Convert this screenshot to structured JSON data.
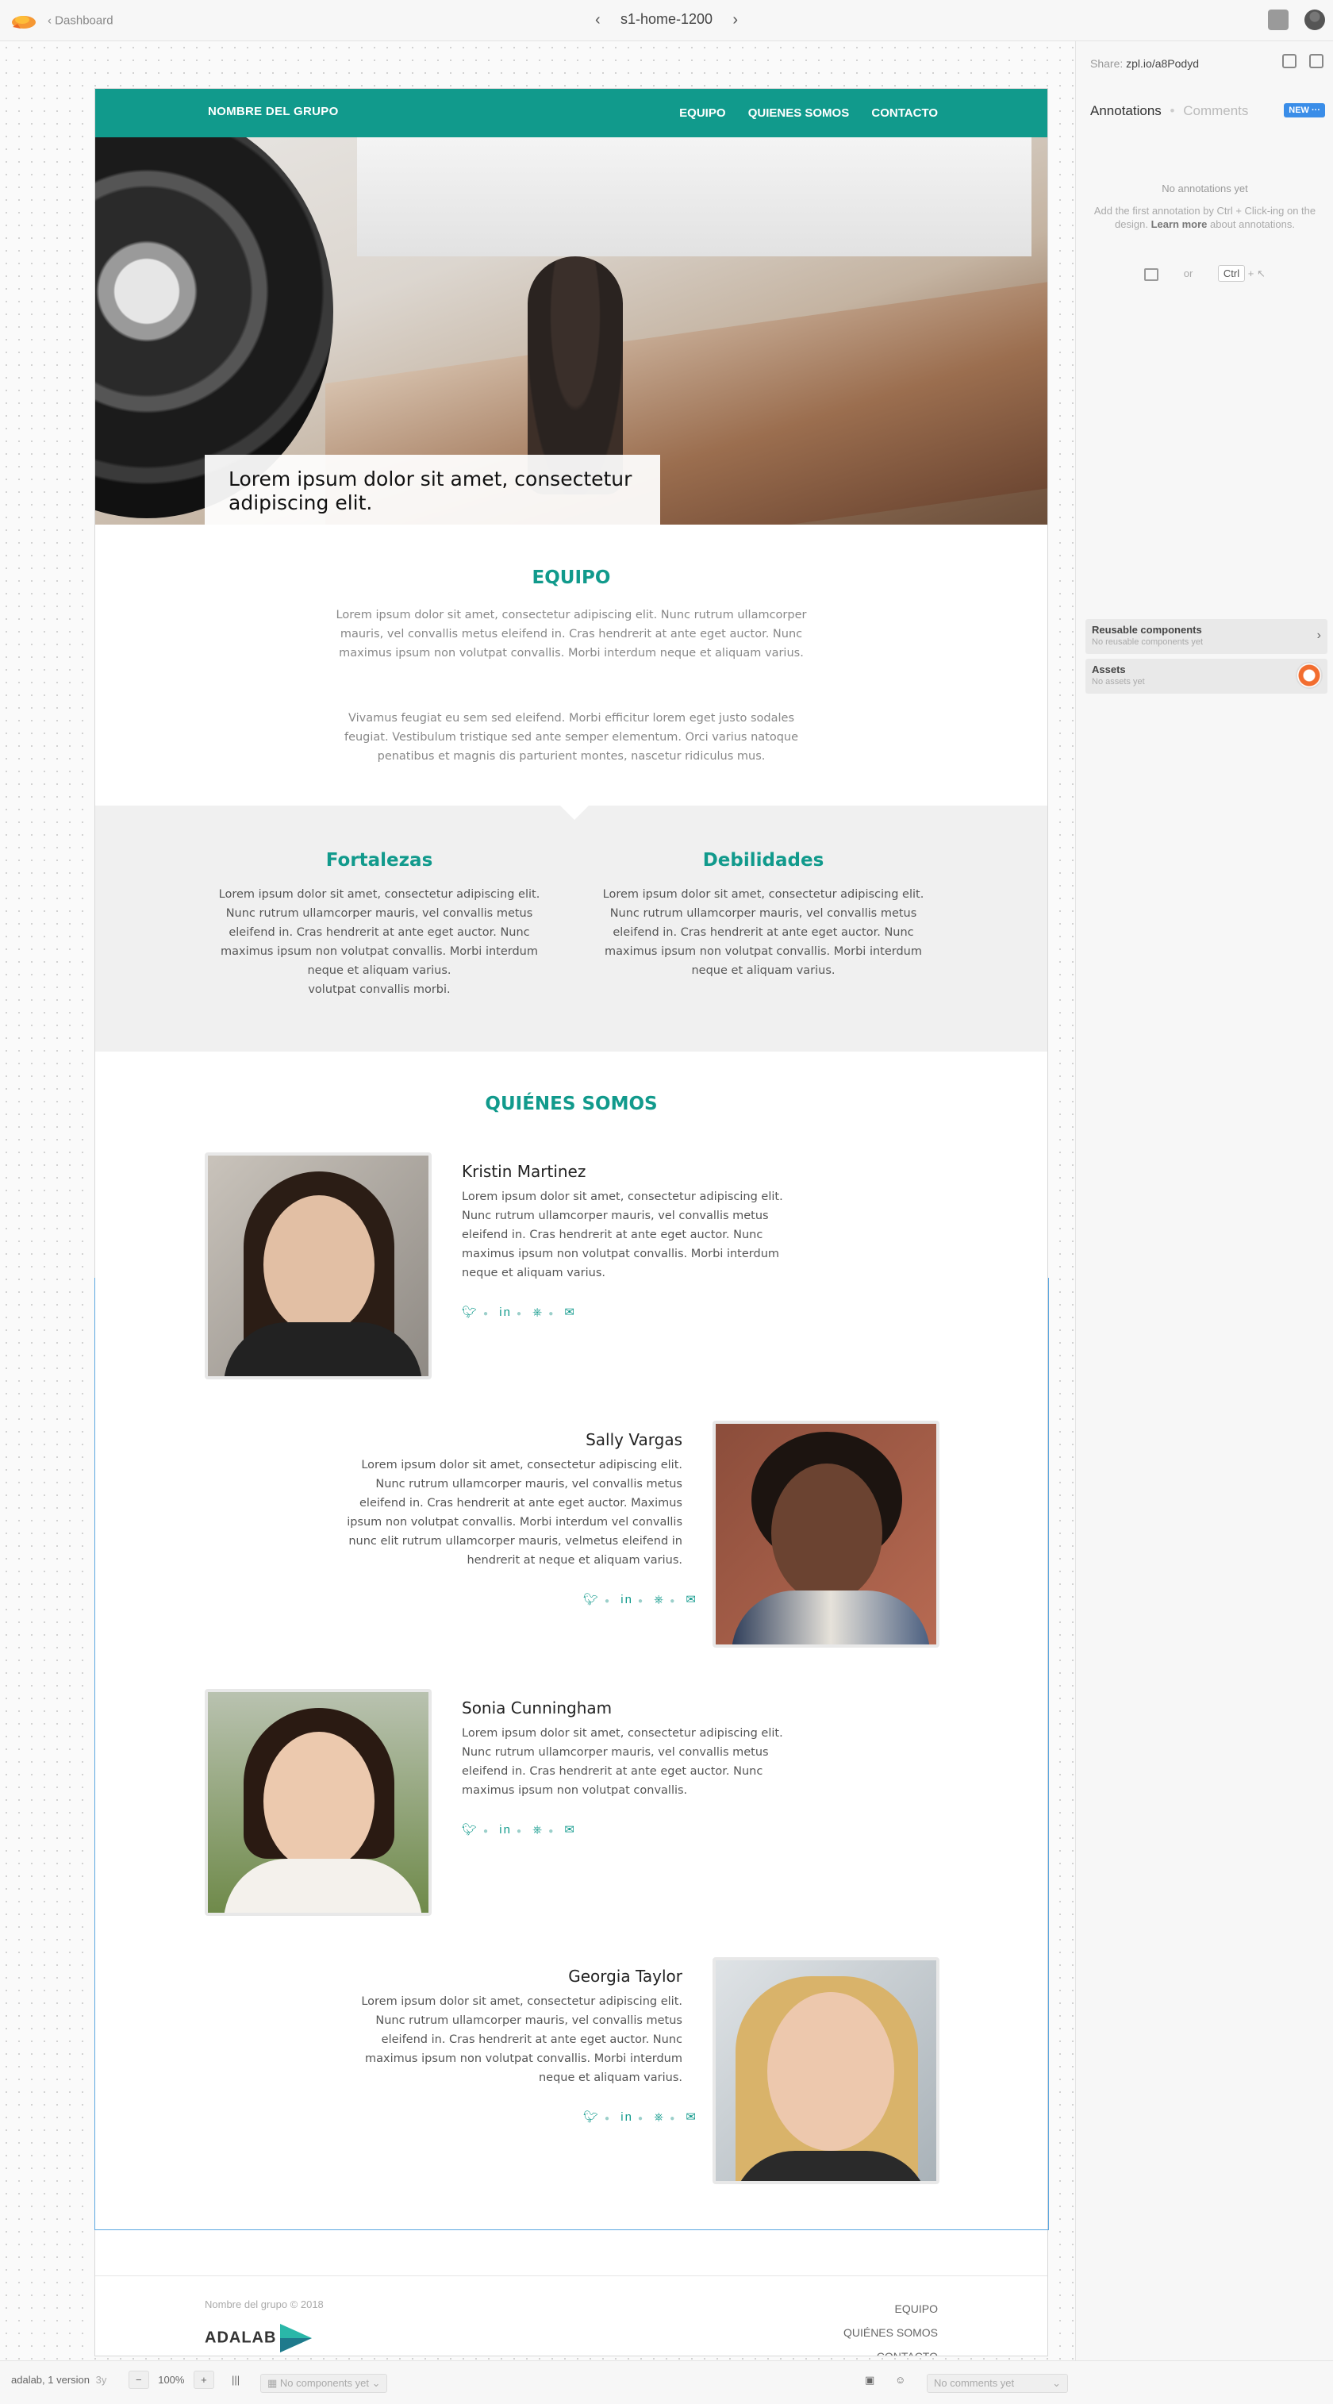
{
  "topbar": {
    "back_label": "Dashboard",
    "page_title": "s1-home-1200"
  },
  "site": {
    "brand": "NOMBRE DEL GRUPO",
    "menu": [
      "EQUIPO",
      "QUIENES SOMOS",
      "CONTACTO"
    ],
    "hero_caption": "Lorem ipsum dolor sit amet, consectetur adipiscing elit.",
    "equipo": {
      "title": "EQUIPO",
      "p1": "Lorem ipsum dolor sit amet, consectetur adipiscing elit. Nunc rutrum ullamcorper mauris, vel convallis metus eleifend in. Cras hendrerit at ante eget auctor. Nunc maximus ipsum non volutpat convallis. Morbi interdum neque et aliquam varius.",
      "p2": "Vivamus feugiat eu sem sed eleifend. Morbi efficitur lorem eget justo sodales feugiat. Vestibulum tristique sed ante semper elementum. Orci varius natoque penatibus et magnis dis parturient montes, nascetur ridiculus mus."
    },
    "fortalezas": {
      "title": "Fortalezas",
      "text": "Lorem ipsum dolor sit amet, consectetur adipiscing elit. Nunc rutrum ullamcorper mauris, vel convallis metus eleifend in. Cras hendrerit at ante eget auctor. Nunc maximus ipsum non volutpat convallis. Morbi interdum neque et aliquam varius.",
      "extra": "volutpat convallis morbi."
    },
    "debilidades": {
      "title": "Debilidades",
      "text": "Lorem ipsum dolor sit amet, consectetur adipiscing elit. Nunc rutrum ullamcorper mauris, vel convallis metus eleifend in. Cras hendrerit at ante eget auctor. Nunc maximus ipsum non volutpat convallis. Morbi interdum neque et aliquam varius."
    },
    "quienes_title": "QUIÉNES SOMOS",
    "people": [
      {
        "name": "Kristin Martinez",
        "bio": "Lorem ipsum dolor sit amet, consectetur adipiscing elit. Nunc rutrum ullamcorper mauris, vel convallis metus eleifend in. Cras hendrerit at ante eget auctor. Nunc maximus ipsum non volutpat convallis. Morbi interdum neque et aliquam varius."
      },
      {
        "name": "Sally Vargas",
        "bio": "Lorem ipsum dolor sit amet, consectetur adipiscing elit. Nunc rutrum ullamcorper mauris, vel convallis metus eleifend in. Cras hendrerit at ante eget auctor. Maximus ipsum non volutpat convallis. Morbi interdum  vel convallis nunc elit rutrum ullamcorper mauris, velmetus eleifend in hendrerit at neque et aliquam varius."
      },
      {
        "name": "Sonia Cunningham",
        "bio": "Lorem ipsum dolor sit amet, consectetur adipiscing elit. Nunc rutrum ullamcorper mauris, vel convallis metus eleifend in. Cras hendrerit at ante eget auctor. Nunc maximus ipsum non volutpat convallis."
      },
      {
        "name": "Georgia Taylor",
        "bio": "Lorem ipsum dolor sit amet, consectetur adipiscing elit. Nunc rutrum ullamcorper mauris, vel convallis metus eleifend in. Cras hendrerit at ante eget auctor. Nunc maximus ipsum non volutpat convallis. Morbi interdum neque et aliquam varius."
      }
    ],
    "social_icons": [
      "twitter-icon",
      "linkedin-icon",
      "github-icon",
      "email-icon"
    ],
    "footer": {
      "copyright": "Nombre del grupo © 2018",
      "logo": "ADALAB",
      "links": [
        "EQUIPO",
        "QUIÉNES SOMOS",
        "CONTACTO"
      ]
    },
    "colors": {
      "accent": "#119a8c",
      "section_bg": "#f0f0f0"
    }
  },
  "panel": {
    "share_label": "Share:",
    "share_url": "zpl.io/a8Podyd",
    "tab_annotations": "Annotations",
    "tab_comments": "Comments",
    "new_badge": "NEW ···",
    "no_annotations": "No annotations yet",
    "hint_pre": "Add the first annotation by Ctrl + Click-ing on the design.",
    "hint_link": "Learn more",
    "hint_post": "about annotations.",
    "or": "or",
    "ctrl": "Ctrl",
    "plus": "+",
    "reusable_title": "Reusable components",
    "reusable_sub": "No reusable components yet",
    "assets_title": "Assets",
    "assets_sub": "No assets yet"
  },
  "bottombar": {
    "version": "adalab, 1 version",
    "age": "3y",
    "zoom": "100%",
    "components": "No components yet",
    "comments": "No comments yet"
  }
}
